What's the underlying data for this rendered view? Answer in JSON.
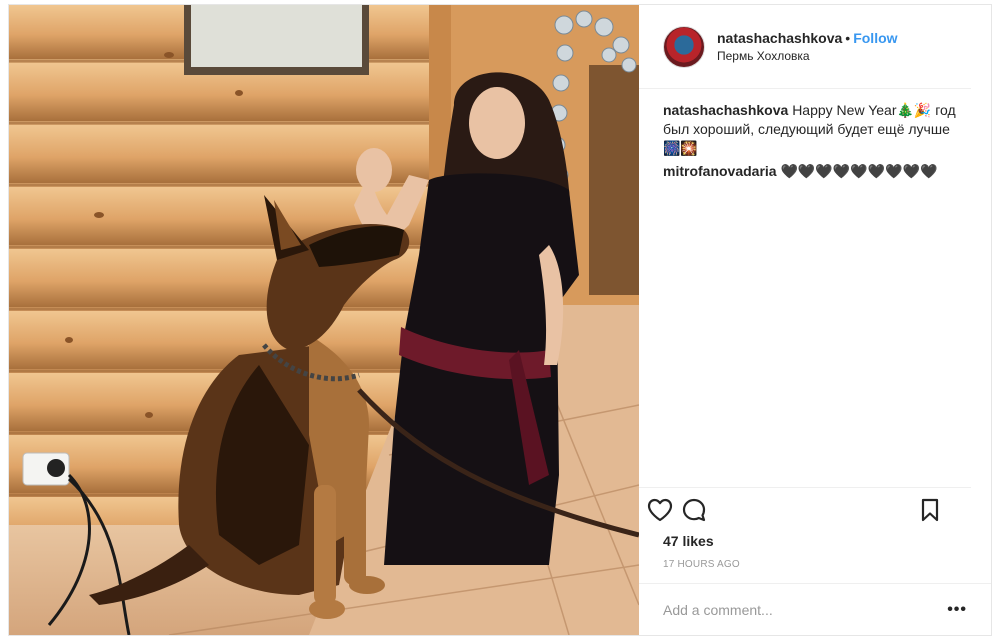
{
  "post": {
    "username": "natashachashkova",
    "follow_label": "Follow",
    "location": "Пермь Хохловка",
    "separator": "•"
  },
  "comments": [
    {
      "user": "natashachashkova",
      "text": "Happy New Year🎄🎉 год был хороший, следующий будет ещё лучше 🎆🎇"
    },
    {
      "user": "mitrofanovadaria",
      "text": "🖤🖤🖤🖤🖤🖤🖤🖤🖤"
    }
  ],
  "actions": {
    "like_icon": "heart-outline-icon",
    "comment_icon": "comment-bubble-icon",
    "save_icon": "bookmark-icon"
  },
  "likes": "47 likes",
  "timestamp": "17 HOURS AGO",
  "add_comment": {
    "placeholder": "Add a comment...",
    "more_label": "•••"
  },
  "colors": {
    "link": "#3897f0",
    "text": "#262626",
    "muted": "#999999",
    "border": "#efefef"
  }
}
